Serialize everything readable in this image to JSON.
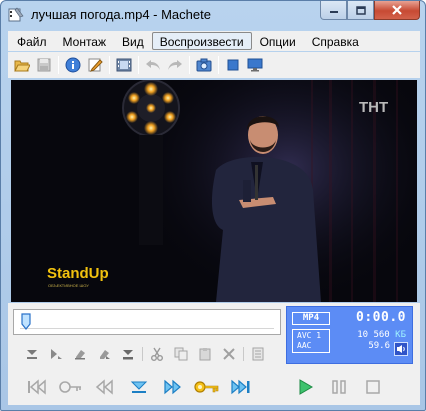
{
  "window": {
    "title": "лучшая погода.mp4 - Machete"
  },
  "menu": {
    "items": [
      "Файл",
      "Монтаж",
      "Вид",
      "Воспроизвести",
      "Опции",
      "Справка"
    ],
    "active_index": 3
  },
  "toolbar": {
    "icons": [
      "open-folder-icon",
      "save-icon",
      "info-icon",
      "edit-tags-icon",
      "film-strip-icon",
      "undo-icon",
      "redo-icon",
      "snapshot-icon",
      "fullscreen-icon",
      "monitor-icon"
    ]
  },
  "video": {
    "channel_logo": "ТНТ",
    "show_logo": "StandUp",
    "show_logo_sub": "ОБЪЕКТИВНОЕ ШОУ"
  },
  "seek": {
    "position_fraction": 0.0
  },
  "edit_toolbar": {
    "icons": [
      "mark-in-icon",
      "mark-out-icon",
      "erase-marker-icon",
      "clear-markers-icon",
      "select-all-icon",
      "cut-icon",
      "copy-icon",
      "paste-icon",
      "delete-icon",
      "list-icon"
    ]
  },
  "playback": {
    "icons": [
      "go-start-icon",
      "key-prev-icon",
      "step-back-icon",
      "marker-icon",
      "step-forward-icon",
      "key-next-icon",
      "go-end-icon",
      "play-icon",
      "pause-icon",
      "stop-icon"
    ]
  },
  "info": {
    "format": "MP4",
    "time": "0:00.0",
    "video_codec": "AVC 1",
    "audio_codec": "AAC",
    "file_size": "10 560",
    "file_size_unit": "КБ",
    "fps": "59.6",
    "colors": {
      "panel": "#5c8cf5",
      "accent": "#9ef0ff"
    }
  }
}
